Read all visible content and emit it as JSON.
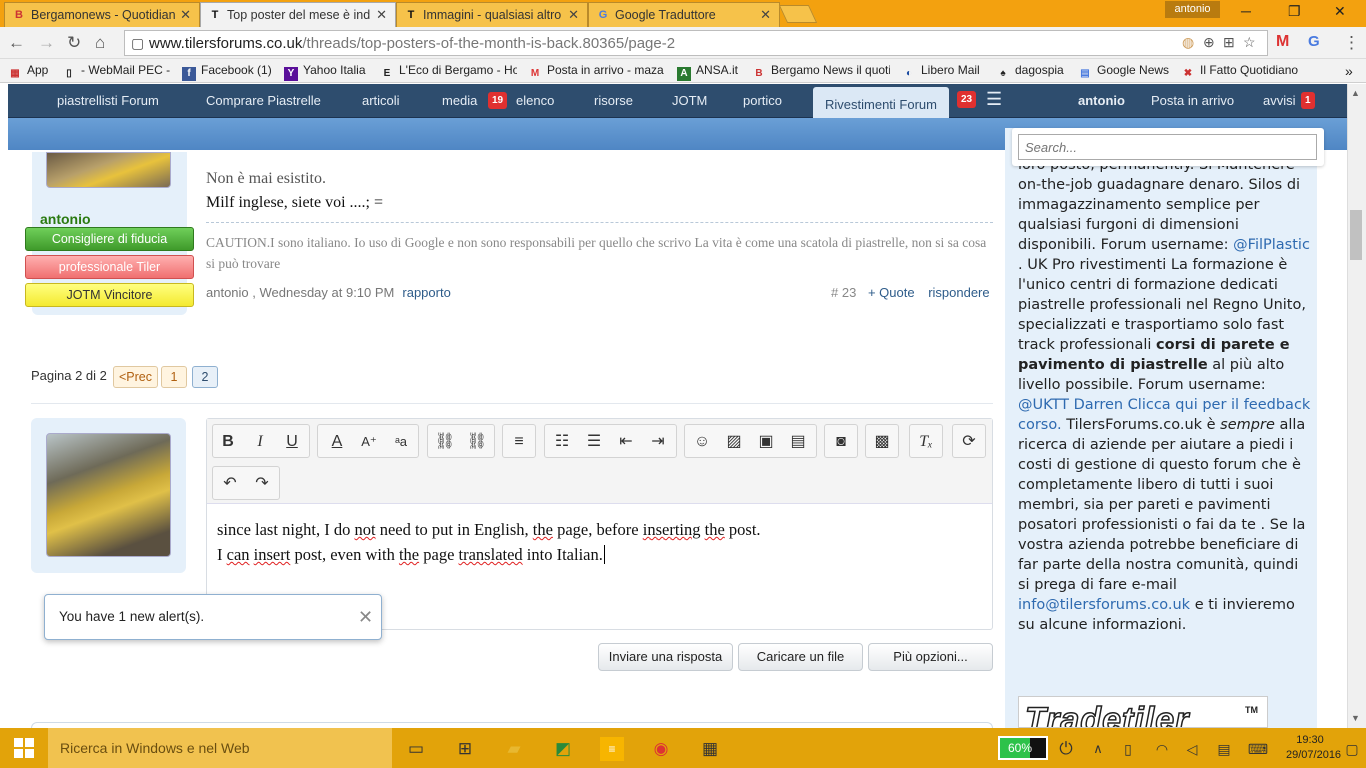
{
  "browser": {
    "tabs": [
      {
        "label": "Bergamonews - Quotidian",
        "icon": "bn-favicon"
      },
      {
        "label": "Top poster del mese è ind",
        "icon": "tilersforums-favicon",
        "active": true
      },
      {
        "label": "Immagini - qualsiasi altro",
        "icon": "tilersforums-favicon"
      },
      {
        "label": "Google Traduttore",
        "icon": "google-translate-favicon"
      }
    ],
    "profile_name": "antonio",
    "url_host": "www.tilersforums.co.uk",
    "url_path": "/threads/top-posters-of-the-month-is-back.80365/page-2",
    "bookmarks": [
      {
        "label": "App",
        "icon": "apps-grid-icon"
      },
      {
        "label": "- WebMail PEC -",
        "icon": "page-icon"
      },
      {
        "label": "Facebook (1)",
        "icon": "facebook-icon"
      },
      {
        "label": "Yahoo Italia",
        "icon": "yahoo-icon"
      },
      {
        "label": "L'Eco di Bergamo - Ho",
        "icon": "eco-icon"
      },
      {
        "label": "Posta in arrivo - maza",
        "icon": "gmail-icon"
      },
      {
        "label": "ANSA.it",
        "icon": "ansa-icon"
      },
      {
        "label": "Bergamo News il quoti",
        "icon": "bn-favicon"
      },
      {
        "label": "Libero Mail",
        "icon": "libero-icon"
      },
      {
        "label": "dagospia",
        "icon": "dagospia-icon"
      },
      {
        "label": "Google News",
        "icon": "google-news-icon"
      },
      {
        "label": "Il Fatto Quotidiano",
        "icon": "fatto-icon"
      }
    ]
  },
  "site_nav": {
    "items": [
      "piastrellisti Forum",
      "Comprare Piastrelle",
      "articoli",
      "media",
      "elenco",
      "risorse",
      "JOTM",
      "portico",
      "Rivestimenti Forum"
    ],
    "media_badge": "19",
    "selected_badge": "23",
    "user": "antonio",
    "inbox": "Posta in arrivo",
    "alerts": "avvisi",
    "alerts_badge": "1"
  },
  "post": {
    "username": "antonio",
    "ribbons": [
      "Consigliere di fiducia",
      "professionale Tiler",
      "JOTM Vincitore"
    ],
    "line1": "Non è mai esistito.",
    "line2": "Milf inglese, siete voi ....; =",
    "signature": "CAUTION.I sono italiano. Io uso di Google e non sono responsabili per quello che scrivo La vita è come una scatola di piastrelle, non si sa cosa si può trovare",
    "meta": "antonio , Wednesday at 9:10 PM",
    "report": "rapporto",
    "number": "# 23",
    "quote": "+ Quote",
    "reply": "rispondere"
  },
  "pagination": {
    "label": "Pagina 2 di 2",
    "prev": "<Prec",
    "pages": [
      "1",
      "2"
    ]
  },
  "editor": {
    "line1": [
      "since last night, I do ",
      "not",
      " need to put in English, ",
      "the",
      " page, before ",
      "inserting",
      " ",
      "the",
      " post."
    ],
    "line2": [
      "I ",
      "can",
      " ",
      "insert",
      " post, even with ",
      "the",
      " page ",
      "translated",
      " into Italian."
    ]
  },
  "alert": {
    "text": "You have 1 new alert(s)."
  },
  "buttons": {
    "submit": "Inviare una risposta",
    "upload": "Caricare un file",
    "more": "Più opzioni..."
  },
  "sidebar": {
    "search_placeholder": "Search...",
    "p1": "loro posto, permanently. Si Mantenere on-the-job guadagnare denaro. Silos di immagazzinamento semplice per qualsiasi furgoni di dimensioni disponibili. Forum username:",
    "link1": "@FilPlastic",
    "p2": ". UK Pro rivestimenti La formazione è l'unico centri di formazione dedicati piastrelle professionali nel Regno Unito, specializzati e trasportiamo solo fast track professionali",
    "bold1": "corsi di parete e pavimento di piastrelle",
    "p3": "al più alto livello possibile. Forum username:",
    "link2": "@UKTT Darren Clicca qui per il feedback corso.",
    "p4": "TilersForums.co.uk è",
    "em1": "sempre",
    "p5": "alla ricerca di aziende per aiutare a piedi i costi di gestione di questo forum che è completamente libero di tutti i suoi membri, sia per pareti e pavimenti posatori professionisti o fai da te . Se la vostra azienda potrebbe beneficiare di far parte della nostra comunità, quindi si prega di fare e-mail",
    "link3": "info@tilersforums.co.uk",
    "p6": "e ti invieremo su alcune informazioni.",
    "logo_text": "Tradetiler",
    "logo_tm": "TM"
  },
  "taskbar": {
    "search_placeholder": "Ricerca in Windows e nel Web",
    "battery": "60%",
    "time": "19:30",
    "date": "29/07/2016"
  }
}
